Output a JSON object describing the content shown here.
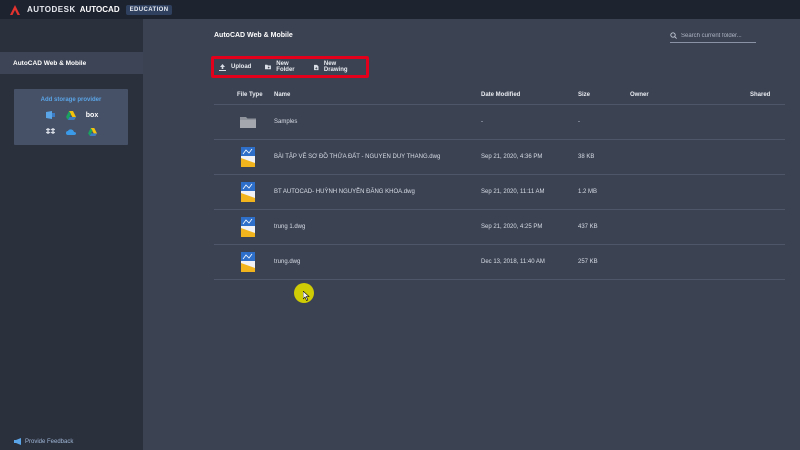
{
  "topbar": {
    "brand": "AUTODESK",
    "product": "AUTOCAD",
    "edition": "EDUCATION"
  },
  "sidebar": {
    "active_item": "AutoCAD Web & Mobile",
    "storage_title": "Add storage provider",
    "providers": [
      "onedrive-icon",
      "google-drive-icon",
      "box-icon",
      "dropbox-icon",
      "onedrive-cloud-icon",
      "google-drive-2-icon"
    ],
    "box_label": "box",
    "feedback": "Provide Feedback"
  },
  "main": {
    "title": "AutoCAD Web & Mobile",
    "search_placeholder": "Search current folder...",
    "toolbar": {
      "upload": "Upload",
      "new_folder": "New Folder",
      "new_drawing": "New Drawing"
    },
    "columns": {
      "file_type": "File Type",
      "name": "Name",
      "date_modified": "Date Modified",
      "size": "Size",
      "owner": "Owner",
      "shared": "Shared"
    },
    "rows": [
      {
        "type": "folder",
        "name": "Samples",
        "date": "-",
        "size": "-"
      },
      {
        "type": "dwg",
        "name": "BÀI TẬP VẼ SƠ ĐỒ THỬA ĐẤT - NGUYEN DUY THANG.dwg",
        "date": "Sep 21, 2020, 4:36 PM",
        "size": "38 KB"
      },
      {
        "type": "dwg",
        "name": "BT AUTOCAD- HUỲNH NGUYỄN ĐĂNG KHOA.dwg",
        "date": "Sep 21, 2020, 11:11 AM",
        "size": "1.2 MB"
      },
      {
        "type": "dwg",
        "name": "trung 1.dwg",
        "date": "Sep 21, 2020, 4:25 PM",
        "size": "437 KB"
      },
      {
        "type": "dwg",
        "name": "trung.dwg",
        "date": "Dec 13, 2018, 11:40 AM",
        "size": "257 KB"
      }
    ]
  },
  "colors": {
    "highlight": "#e2001a",
    "link": "#5aa5e8",
    "cursor": "#d7d300"
  }
}
